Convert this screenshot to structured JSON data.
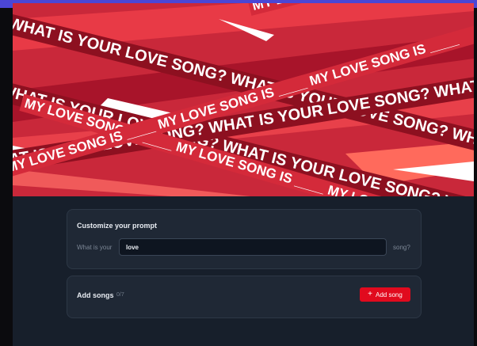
{
  "banner": {
    "phrase_a": "WHAT IS YOUR LOVE SONG? WHAT IS YOUR LOVE SONG? WHAT IS YOUR LOVE SONG?",
    "phrase_b": "MY LOVE SONG IS ____ MY LOVE SONG IS ____ MY LOVE SONG IS ____"
  },
  "prompt": {
    "title": "Customize your prompt",
    "prefix": "What is your",
    "value": "love",
    "suffix": "song?"
  },
  "songs": {
    "title": "Add songs",
    "count": "0/7",
    "add_label": "Add song"
  },
  "colors": {
    "accent_red": "#e10a1e",
    "frame_bg": "#171f2b",
    "card_bg": "#1f2835",
    "top_accent": "#4b46d6"
  },
  "icons": {
    "add": "plus-icon"
  }
}
